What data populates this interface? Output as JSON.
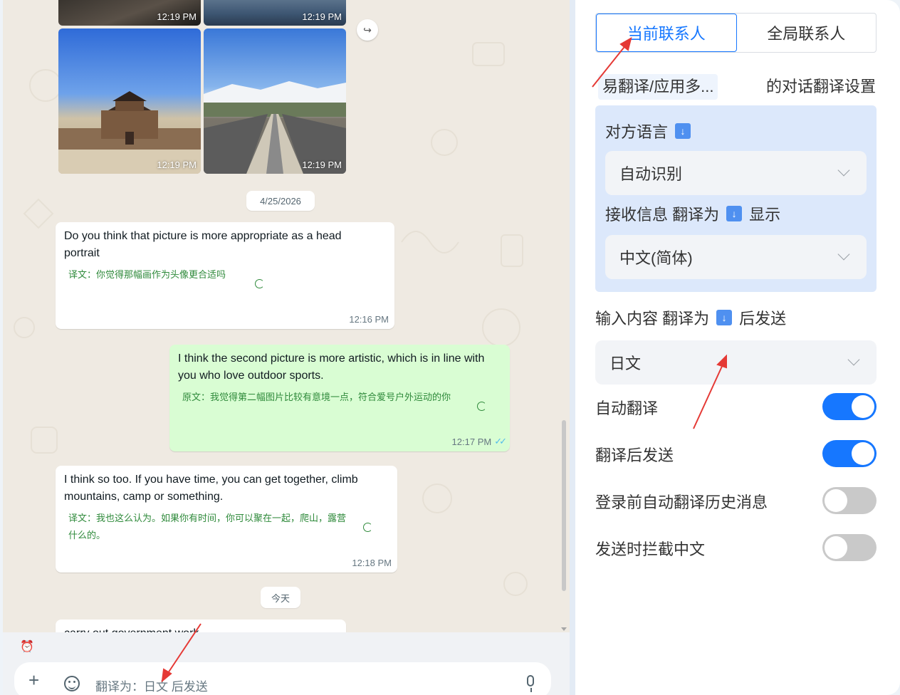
{
  "chat": {
    "photos": [
      {
        "time": "12:19 PM"
      },
      {
        "time": "12:19 PM"
      },
      {
        "time": "12:19 PM"
      },
      {
        "time": "12:19 PM"
      }
    ],
    "date_chip": "4/25/2026",
    "today_chip": "今天",
    "messages": [
      {
        "direction": "incoming",
        "text": "Do you think that picture is more appropriate as a head portrait",
        "translation": "译文：你觉得那幅画作为头像更合适吗",
        "time": "12:16 PM"
      },
      {
        "direction": "outgoing",
        "text": "I think the second picture is more artistic, which is in line with you who love outdoor sports.",
        "translation": "原文：我觉得第二幅图片比较有意境一点，符合爱号户外运动的你",
        "time": "12:17 PM"
      },
      {
        "direction": "incoming",
        "text": "I think so too. If you have time, you can get together, climb mountains, camp or something.",
        "translation": "译文：我也这么认为。如果你有时间，你可以聚在一起，爬山，露营什么的。",
        "time": "12:18 PM"
      }
    ],
    "partial_message": "carry out government work",
    "input_placeholder": "翻译为：日文 后发送"
  },
  "panel": {
    "tabs": [
      {
        "label": "当前联系人",
        "active": true
      },
      {
        "label": "全局联系人",
        "active": false
      }
    ],
    "contact_name": "易翻译/应用多...",
    "contact_suffix": "的对话翻译设置",
    "peer_language_label": "对方语言",
    "peer_language_value": "自动识别",
    "receive_label_pre": "接收信息 翻译为",
    "receive_label_post": "显示",
    "receive_value": "中文(简体)",
    "input_label_pre": "输入内容 翻译为",
    "input_label_post": "后发送",
    "input_value": "日文",
    "toggles": [
      {
        "label": "自动翻译",
        "on": true
      },
      {
        "label": "翻译后发送",
        "on": true
      },
      {
        "label": "登录前自动翻译历史消息",
        "on": false
      },
      {
        "label": "发送时拦截中文",
        "on": false
      }
    ]
  },
  "colors": {
    "accent": "#1677ff",
    "outgoing_bubble": "#d9fdd3",
    "translation_text": "#2f8a3b",
    "annotation_arrow": "#e53935"
  }
}
